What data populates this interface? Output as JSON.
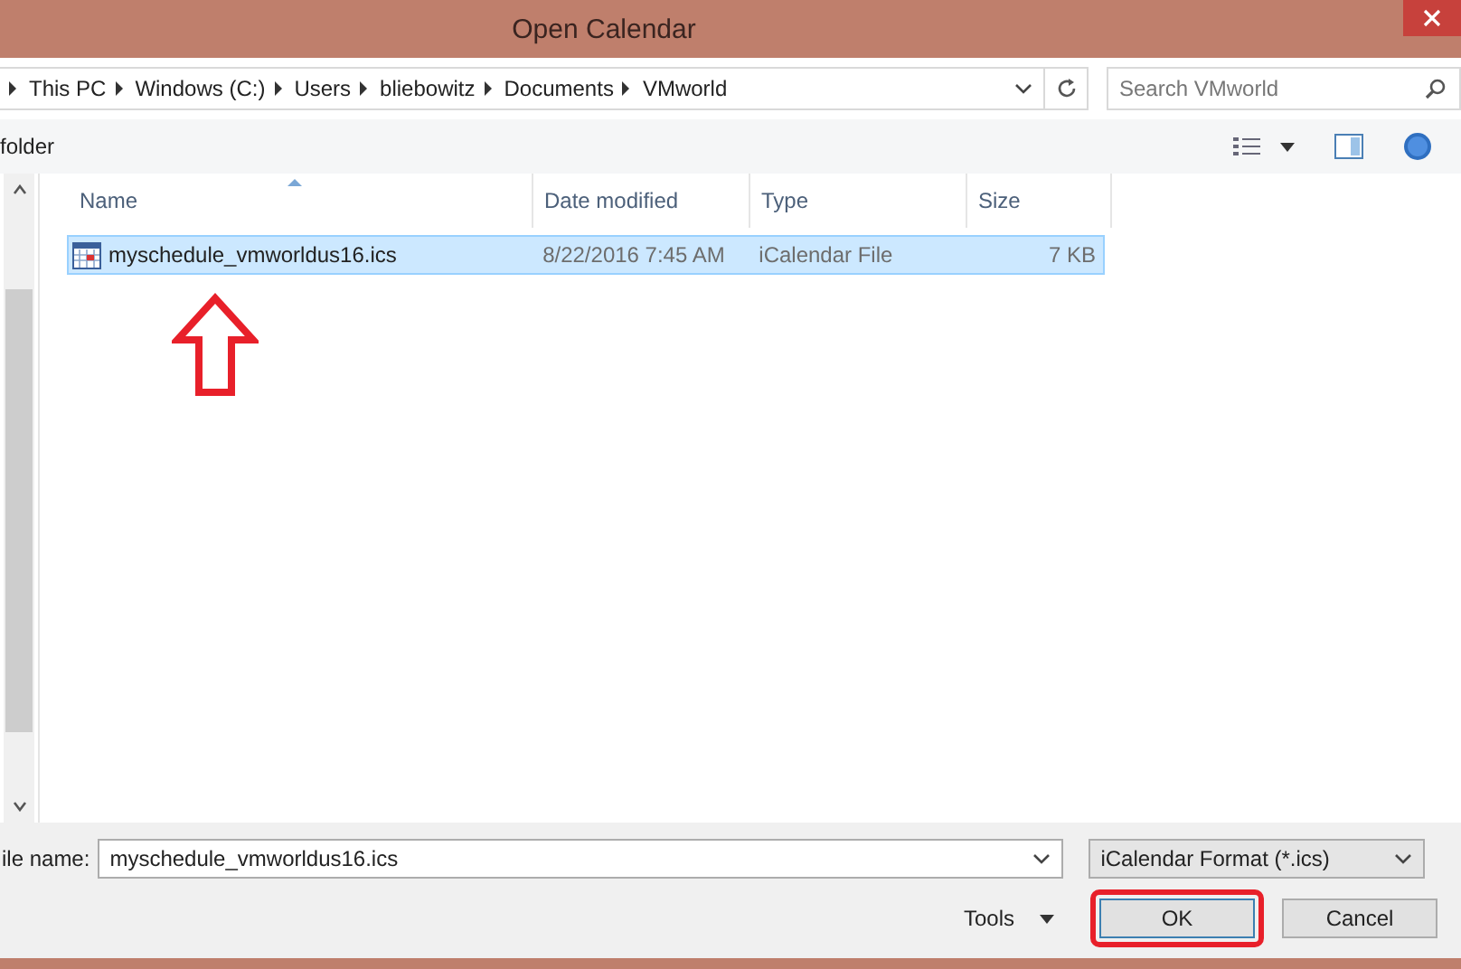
{
  "window": {
    "title": "Open Calendar"
  },
  "address": {
    "path": [
      "This PC",
      "Windows (C:)",
      "Users",
      "bliebowitz",
      "Documents",
      "VMworld"
    ]
  },
  "search": {
    "placeholder": "Search VMworld"
  },
  "toolbar": {
    "label": "folder"
  },
  "table": {
    "columns": [
      "Name",
      "Date modified",
      "Type",
      "Size"
    ],
    "rows": [
      {
        "name": "myschedule_vmworldus16.ics",
        "date": "8/22/2016 7:45 AM",
        "type": "iCalendar File",
        "size": "7 KB",
        "selected": true
      }
    ]
  },
  "footer": {
    "filename_label": "ile name:",
    "filename": "myschedule_vmworldus16.ics",
    "filter": "iCalendar Format (*.ics)",
    "tools": "Tools",
    "ok": "OK",
    "cancel": "Cancel"
  }
}
